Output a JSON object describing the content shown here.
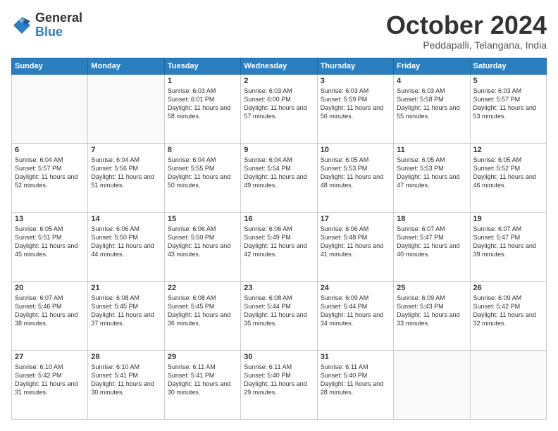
{
  "logo": {
    "general": "General",
    "blue": "Blue"
  },
  "header": {
    "month": "October 2024",
    "location": "Peddapalli, Telangana, India"
  },
  "weekdays": [
    "Sunday",
    "Monday",
    "Tuesday",
    "Wednesday",
    "Thursday",
    "Friday",
    "Saturday"
  ],
  "weeks": [
    [
      {
        "day": "",
        "text": ""
      },
      {
        "day": "",
        "text": ""
      },
      {
        "day": "1",
        "text": "Sunrise: 6:03 AM\nSunset: 6:01 PM\nDaylight: 11 hours and 58 minutes."
      },
      {
        "day": "2",
        "text": "Sunrise: 6:03 AM\nSunset: 6:00 PM\nDaylight: 11 hours and 57 minutes."
      },
      {
        "day": "3",
        "text": "Sunrise: 6:03 AM\nSunset: 5:59 PM\nDaylight: 11 hours and 56 minutes."
      },
      {
        "day": "4",
        "text": "Sunrise: 6:03 AM\nSunset: 5:58 PM\nDaylight: 11 hours and 55 minutes."
      },
      {
        "day": "5",
        "text": "Sunrise: 6:03 AM\nSunset: 5:57 PM\nDaylight: 11 hours and 53 minutes."
      }
    ],
    [
      {
        "day": "6",
        "text": "Sunrise: 6:04 AM\nSunset: 5:57 PM\nDaylight: 11 hours and 52 minutes."
      },
      {
        "day": "7",
        "text": "Sunrise: 6:04 AM\nSunset: 5:56 PM\nDaylight: 11 hours and 51 minutes."
      },
      {
        "day": "8",
        "text": "Sunrise: 6:04 AM\nSunset: 5:55 PM\nDaylight: 11 hours and 50 minutes."
      },
      {
        "day": "9",
        "text": "Sunrise: 6:04 AM\nSunset: 5:54 PM\nDaylight: 11 hours and 49 minutes."
      },
      {
        "day": "10",
        "text": "Sunrise: 6:05 AM\nSunset: 5:53 PM\nDaylight: 11 hours and 48 minutes."
      },
      {
        "day": "11",
        "text": "Sunrise: 6:05 AM\nSunset: 5:53 PM\nDaylight: 11 hours and 47 minutes."
      },
      {
        "day": "12",
        "text": "Sunrise: 6:05 AM\nSunset: 5:52 PM\nDaylight: 11 hours and 46 minutes."
      }
    ],
    [
      {
        "day": "13",
        "text": "Sunrise: 6:05 AM\nSunset: 5:51 PM\nDaylight: 11 hours and 45 minutes."
      },
      {
        "day": "14",
        "text": "Sunrise: 6:06 AM\nSunset: 5:50 PM\nDaylight: 11 hours and 44 minutes."
      },
      {
        "day": "15",
        "text": "Sunrise: 6:06 AM\nSunset: 5:50 PM\nDaylight: 11 hours and 43 minutes."
      },
      {
        "day": "16",
        "text": "Sunrise: 6:06 AM\nSunset: 5:49 PM\nDaylight: 11 hours and 42 minutes."
      },
      {
        "day": "17",
        "text": "Sunrise: 6:06 AM\nSunset: 5:48 PM\nDaylight: 11 hours and 41 minutes."
      },
      {
        "day": "18",
        "text": "Sunrise: 6:07 AM\nSunset: 5:47 PM\nDaylight: 11 hours and 40 minutes."
      },
      {
        "day": "19",
        "text": "Sunrise: 6:07 AM\nSunset: 5:47 PM\nDaylight: 11 hours and 39 minutes."
      }
    ],
    [
      {
        "day": "20",
        "text": "Sunrise: 6:07 AM\nSunset: 5:46 PM\nDaylight: 11 hours and 38 minutes."
      },
      {
        "day": "21",
        "text": "Sunrise: 6:08 AM\nSunset: 5:45 PM\nDaylight: 11 hours and 37 minutes."
      },
      {
        "day": "22",
        "text": "Sunrise: 6:08 AM\nSunset: 5:45 PM\nDaylight: 11 hours and 36 minutes."
      },
      {
        "day": "23",
        "text": "Sunrise: 6:08 AM\nSunset: 5:44 PM\nDaylight: 11 hours and 35 minutes."
      },
      {
        "day": "24",
        "text": "Sunrise: 6:09 AM\nSunset: 5:44 PM\nDaylight: 11 hours and 34 minutes."
      },
      {
        "day": "25",
        "text": "Sunrise: 6:09 AM\nSunset: 5:43 PM\nDaylight: 11 hours and 33 minutes."
      },
      {
        "day": "26",
        "text": "Sunrise: 6:09 AM\nSunset: 5:42 PM\nDaylight: 11 hours and 32 minutes."
      }
    ],
    [
      {
        "day": "27",
        "text": "Sunrise: 6:10 AM\nSunset: 5:42 PM\nDaylight: 11 hours and 31 minutes."
      },
      {
        "day": "28",
        "text": "Sunrise: 6:10 AM\nSunset: 5:41 PM\nDaylight: 11 hours and 30 minutes."
      },
      {
        "day": "29",
        "text": "Sunrise: 6:11 AM\nSunset: 5:41 PM\nDaylight: 11 hours and 30 minutes."
      },
      {
        "day": "30",
        "text": "Sunrise: 6:11 AM\nSunset: 5:40 PM\nDaylight: 11 hours and 29 minutes."
      },
      {
        "day": "31",
        "text": "Sunrise: 6:11 AM\nSunset: 5:40 PM\nDaylight: 11 hours and 28 minutes."
      },
      {
        "day": "",
        "text": ""
      },
      {
        "day": "",
        "text": ""
      }
    ]
  ]
}
